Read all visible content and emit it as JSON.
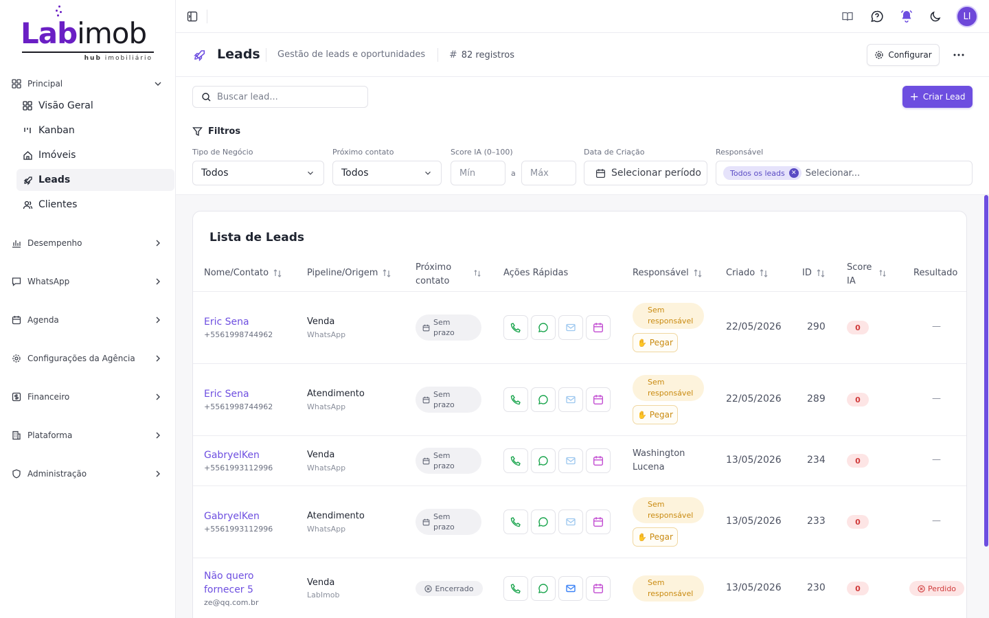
{
  "brand": {
    "logo_main_a": "Lab",
    "logo_main_b": "imob",
    "logo_tag_a": "hub",
    "logo_tag_b": "imobiliário",
    "accent": "#6d4ee0"
  },
  "sidebar": {
    "principal": "Principal",
    "items": [
      {
        "label": "Visão Geral",
        "icon": "dashboard-icon"
      },
      {
        "label": "Kanban",
        "icon": "kanban-icon"
      },
      {
        "label": "Imóveis",
        "icon": "home-icon"
      },
      {
        "label": "Leads",
        "icon": "rocket-icon"
      },
      {
        "label": "Clientes",
        "icon": "users-icon"
      }
    ],
    "sections": [
      {
        "label": "Desempenho",
        "icon": "bar-chart-icon"
      },
      {
        "label": "WhatsApp",
        "icon": "message-icon"
      },
      {
        "label": "Agenda",
        "icon": "calendar-icon"
      },
      {
        "label": "Configurações da Agência",
        "icon": "gear-icon"
      },
      {
        "label": "Financeiro",
        "icon": "dollar-icon"
      },
      {
        "label": "Plataforma",
        "icon": "building-icon"
      },
      {
        "label": "Administração",
        "icon": "shield-icon"
      }
    ]
  },
  "topbar": {
    "avatar": "LI"
  },
  "header": {
    "title": "Leads",
    "subtitle": "Gestão de leads e oportunidades",
    "count": "82 registros",
    "config": "Configurar"
  },
  "filters": {
    "search_placeholder": "Buscar lead...",
    "create": "Criar Lead",
    "title": "Filtros",
    "tipo_label": "Tipo de Negócio",
    "tipo_value": "Todos",
    "proximo_label": "Próximo contato",
    "proximo_value": "Todos",
    "score_label": "Score IA (0–100)",
    "min": "Mín",
    "a": "a",
    "max": "Máx",
    "data_label": "Data de Criação",
    "data_value": "Selecionar período",
    "resp_label": "Responsável",
    "resp_chip": "Todos os leads",
    "resp_placeholder": "Selecionar..."
  },
  "table": {
    "title": "Lista de Leads",
    "headers": {
      "nome": "Nome/Contato",
      "pipeline": "Pipeline/Origem",
      "proximo_a": "Próximo",
      "proximo_b": "contato",
      "acoes": "Ações Rápidas",
      "responsavel": "Responsável",
      "criado": "Criado",
      "id": "ID",
      "score_a": "Score",
      "score_b": "IA",
      "resultado": "Resultado"
    },
    "rows": [
      {
        "name": "Eric Sena",
        "contact": "+5561998744962",
        "pipeline": "Venda",
        "origin": "WhatsApp",
        "next_a": "Sem",
        "next_b": "prazo",
        "resp_a": "Sem",
        "resp_b": "responsável",
        "pegar": "Pegar",
        "created": "22/05/2026",
        "id": "290",
        "score": "0",
        "result": "—"
      },
      {
        "name": "Eric Sena",
        "contact": "+5561998744962",
        "pipeline": "Atendimento",
        "origin": "WhatsApp",
        "next_a": "Sem",
        "next_b": "prazo",
        "resp_a": "Sem",
        "resp_b": "responsável",
        "pegar": "Pegar",
        "created": "22/05/2026",
        "id": "289",
        "score": "0",
        "result": "—"
      },
      {
        "name": "GabryelKen",
        "contact": "+5561993112996",
        "pipeline": "Venda",
        "origin": "WhatsApp",
        "next_a": "Sem",
        "next_b": "prazo",
        "resp_name_a": "Washington",
        "resp_name_b": "Lucena",
        "created": "13/05/2026",
        "id": "234",
        "score": "0",
        "result": "—"
      },
      {
        "name": "GabryelKen",
        "contact": "+5561993112996",
        "pipeline": "Atendimento",
        "origin": "WhatsApp",
        "next_a": "Sem",
        "next_b": "prazo",
        "resp_a": "Sem",
        "resp_b": "responsável",
        "pegar": "Pegar",
        "created": "13/05/2026",
        "id": "233",
        "score": "0",
        "result": "—"
      },
      {
        "name_a": "Não quero",
        "name_b": "fornecer 5",
        "contact": "ze@qq.com.br",
        "pipeline": "Venda",
        "origin": "LabImob",
        "next": "Encerrado",
        "resp_a": "Sem",
        "resp_b": "responsável",
        "created": "13/05/2026",
        "id": "230",
        "score": "0",
        "result": "Perdido"
      }
    ]
  }
}
